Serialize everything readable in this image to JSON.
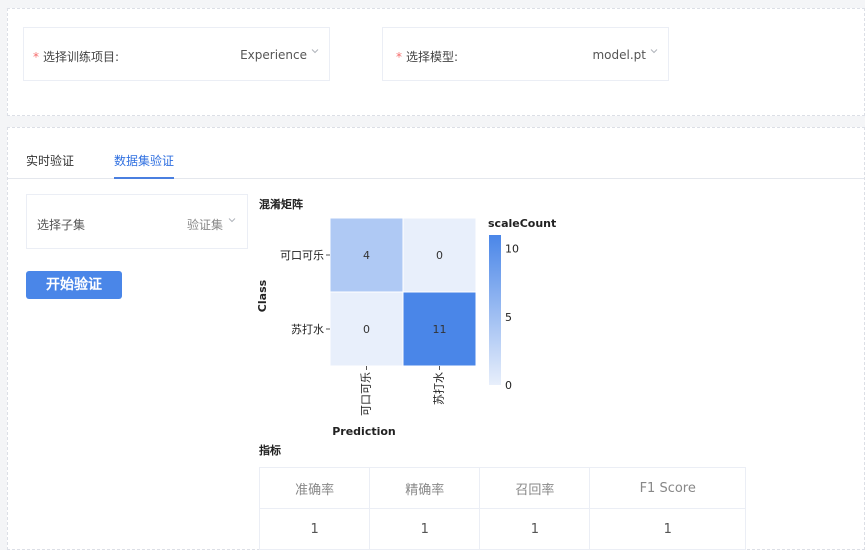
{
  "top": {
    "project_select": {
      "label": "选择训练项目:",
      "value": "Experience"
    },
    "model_select": {
      "label": "选择模型:",
      "value": "model.pt"
    }
  },
  "tabs": [
    {
      "label": "实时验证",
      "active": false
    },
    {
      "label": "数据集验证",
      "active": true
    }
  ],
  "subset_select": {
    "label": "选择子集",
    "value": "验证集"
  },
  "start_button": {
    "label": "开始验证"
  },
  "confusion_title": "混淆矩阵",
  "metrics_title": "指标",
  "colors": {
    "accent": "#4a86e8",
    "required": "#f56c6c",
    "heat_high": "#4a86e8",
    "heat_low": "#e8effb"
  },
  "chart_data": {
    "type": "heatmap",
    "title": "混淆矩阵",
    "xlabel": "Prediction",
    "ylabel": "Class",
    "x_categories": [
      "可口可乐",
      "苏打水"
    ],
    "y_categories": [
      "可口可乐",
      "苏打水"
    ],
    "values": [
      [
        4,
        0
      ],
      [
        0,
        11
      ]
    ],
    "colorbar": {
      "label": "scaleCount",
      "ticks": [
        0,
        5,
        10
      ],
      "range": [
        0,
        11
      ]
    }
  },
  "metrics_table": {
    "headers": [
      "准确率",
      "精确率",
      "召回率",
      "F1 Score"
    ],
    "rows": [
      [
        "1",
        "1",
        "1",
        "1"
      ]
    ]
  }
}
